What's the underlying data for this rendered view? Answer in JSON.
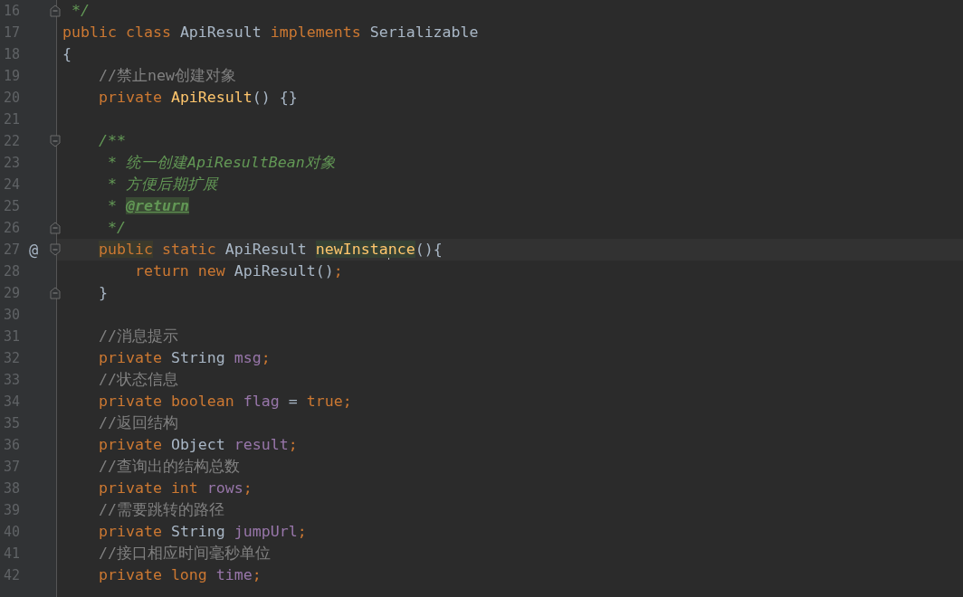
{
  "editor": {
    "lines": [
      {
        "number": "16",
        "fold_end": true,
        "tokens": [
          {
            "text": " */",
            "kind": "doc"
          }
        ]
      },
      {
        "number": "17",
        "tokens": [
          {
            "text": "public class ",
            "kind": "keyword"
          },
          {
            "text": "ApiResult ",
            "kind": "plain"
          },
          {
            "text": "implements ",
            "kind": "keyword"
          },
          {
            "text": "Serializable",
            "kind": "plain"
          }
        ]
      },
      {
        "number": "18",
        "tokens": [
          {
            "text": "{",
            "kind": "plain"
          }
        ]
      },
      {
        "number": "19",
        "tokens": [
          {
            "text": "    //禁止new创建对象",
            "kind": "comment"
          }
        ]
      },
      {
        "number": "20",
        "tokens": [
          {
            "text": "    private ",
            "kind": "keyword"
          },
          {
            "text": "ApiResult",
            "kind": "method"
          },
          {
            "text": "() {}",
            "kind": "plain"
          }
        ]
      },
      {
        "number": "21"
      },
      {
        "number": "22",
        "fold_start": true,
        "tokens": [
          {
            "text": "    /**",
            "kind": "doc"
          }
        ]
      },
      {
        "number": "23",
        "tokens": [
          {
            "text": "     * 统一创建ApiResultBean对象",
            "kind": "doc"
          }
        ]
      },
      {
        "number": "24",
        "tokens": [
          {
            "text": "     * 方便后期扩展",
            "kind": "doc"
          }
        ]
      },
      {
        "number": "25",
        "tokens": [
          {
            "text": "     * ",
            "kind": "doc"
          },
          {
            "text": "@return",
            "kind": "doctag"
          }
        ]
      },
      {
        "number": "26",
        "fold_end": true,
        "tokens": [
          {
            "text": "     */",
            "kind": "doc"
          }
        ]
      },
      {
        "number": "27",
        "marker": "@",
        "fold_start": true,
        "current": true,
        "tokens": [
          {
            "text": "    public",
            "kind": "keyword",
            "highlighted": true
          },
          {
            "text": " static ",
            "kind": "keyword"
          },
          {
            "text": "ApiResult ",
            "kind": "plain"
          },
          {
            "text": "newInsta",
            "kind": "method",
            "highlighted": true,
            "caret": true
          },
          {
            "text": "nce",
            "kind": "method",
            "highlighted": true
          },
          {
            "text": "(){",
            "kind": "plain"
          }
        ]
      },
      {
        "number": "28",
        "tokens": [
          {
            "text": "        return new ",
            "kind": "keyword"
          },
          {
            "text": "ApiResult",
            "kind": "plain"
          },
          {
            "text": "()",
            "kind": "plain"
          },
          {
            "text": ";",
            "kind": "keyword"
          }
        ]
      },
      {
        "number": "29",
        "fold_end": true,
        "tokens": [
          {
            "text": "    }",
            "kind": "plain"
          }
        ]
      },
      {
        "number": "30"
      },
      {
        "number": "31",
        "tokens": [
          {
            "text": "    //消息提示",
            "kind": "comment"
          }
        ]
      },
      {
        "number": "32",
        "tokens": [
          {
            "text": "    private ",
            "kind": "keyword"
          },
          {
            "text": "String ",
            "kind": "plain"
          },
          {
            "text": "msg",
            "kind": "field"
          },
          {
            "text": ";",
            "kind": "keyword"
          }
        ]
      },
      {
        "number": "33",
        "tokens": [
          {
            "text": "    //状态信息",
            "kind": "comment"
          }
        ]
      },
      {
        "number": "34",
        "tokens": [
          {
            "text": "    private boolean ",
            "kind": "keyword"
          },
          {
            "text": "flag ",
            "kind": "field"
          },
          {
            "text": "= ",
            "kind": "plain"
          },
          {
            "text": "true;",
            "kind": "keyword"
          }
        ]
      },
      {
        "number": "35",
        "tokens": [
          {
            "text": "    //返回结构",
            "kind": "comment"
          }
        ]
      },
      {
        "number": "36",
        "tokens": [
          {
            "text": "    private ",
            "kind": "keyword"
          },
          {
            "text": "Object ",
            "kind": "plain"
          },
          {
            "text": "result",
            "kind": "field"
          },
          {
            "text": ";",
            "kind": "keyword"
          }
        ]
      },
      {
        "number": "37",
        "tokens": [
          {
            "text": "    //查询出的结构总数",
            "kind": "comment"
          }
        ]
      },
      {
        "number": "38",
        "tokens": [
          {
            "text": "    private int ",
            "kind": "keyword"
          },
          {
            "text": "rows",
            "kind": "field"
          },
          {
            "text": ";",
            "kind": "keyword"
          }
        ]
      },
      {
        "number": "39",
        "tokens": [
          {
            "text": "    //需要跳转的路径",
            "kind": "comment"
          }
        ]
      },
      {
        "number": "40",
        "tokens": [
          {
            "text": "    private ",
            "kind": "keyword"
          },
          {
            "text": "String ",
            "kind": "plain"
          },
          {
            "text": "jumpUrl",
            "kind": "field"
          },
          {
            "text": ";",
            "kind": "keyword"
          }
        ]
      },
      {
        "number": "41",
        "tokens": [
          {
            "text": "    //接口相应时间毫秒单位",
            "kind": "comment"
          }
        ]
      },
      {
        "number": "42",
        "tokens": [
          {
            "text": "    private long ",
            "kind": "keyword"
          },
          {
            "text": "time",
            "kind": "field"
          },
          {
            "text": ";",
            "kind": "keyword"
          }
        ]
      }
    ]
  }
}
